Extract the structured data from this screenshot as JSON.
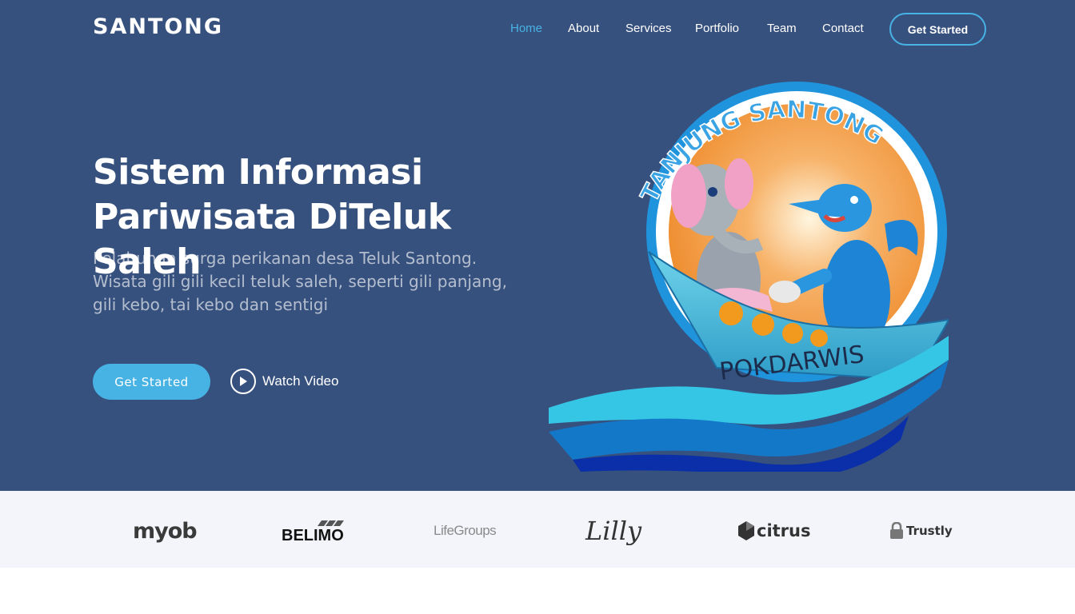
{
  "header": {
    "logo": "SANTONG",
    "nav": [
      {
        "label": "Home",
        "active": true
      },
      {
        "label": "About"
      },
      {
        "label": "Services"
      },
      {
        "label": "Portfolio"
      },
      {
        "label": "Team"
      },
      {
        "label": "Contact"
      }
    ],
    "cta": "Get Started"
  },
  "hero": {
    "title_line1": "Sistem Informasi",
    "title_line2": "Pariwisata DiTeluk Saleh",
    "subtitle": "Pelabuhan surga perikanan desa Teluk Santong. Wisata gili gili kecil teluk saleh, seperti gili panjang, gili kebo, tai kebo dan sentigi",
    "primary_button": "Get Started",
    "video_button": "Watch Video",
    "image": {
      "top_text": "TANJUNG SANTONG",
      "boat_text": "POKDARWIS"
    }
  },
  "clients": [
    {
      "name": "myob",
      "icon": "myob-logo"
    },
    {
      "name": "BELIMO",
      "icon": "belimo-logo"
    },
    {
      "name": "LifeGroups",
      "icon": "lifegroups-logo"
    },
    {
      "name": "Lilly",
      "icon": "lilly-logo"
    },
    {
      "name": "citrus",
      "icon": "citrus-logo"
    },
    {
      "name": "Trustly",
      "icon": "trustly-logo"
    }
  ],
  "colors": {
    "hero_bg": "#37517e",
    "accent": "#47b2e4",
    "clients_bg": "#f3f5fa"
  }
}
